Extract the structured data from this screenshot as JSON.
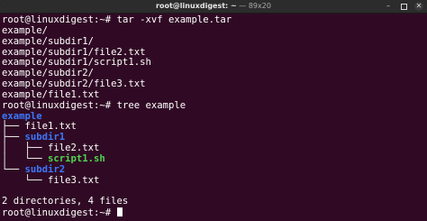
{
  "window": {
    "title_user": "root@linuxdigest: ~",
    "title_size": "89x20",
    "minimize_label": "–",
    "close_label": "✕"
  },
  "terminal": {
    "prompt": "root@linuxdigest:~#",
    "cmd1": " tar -xvf example.tar",
    "out": [
      "example/",
      "example/subdir1/",
      "example/subdir1/file2.txt",
      "example/subdir1/script1.sh",
      "example/subdir2/",
      "example/subdir2/file3.txt",
      "example/file1.txt"
    ],
    "cmd2": " tree example",
    "tree": {
      "root": "example",
      "l1_prefix": "├── ",
      "l1_file": "file1.txt",
      "l2_prefix": "├── ",
      "l2_dir": "subdir1",
      "l3_prefix": "│   ├── ",
      "l3_file": "file2.txt",
      "l4_prefix": "│   └── ",
      "l4_exec": "script1.sh",
      "l5_prefix": "└── ",
      "l5_dir": "subdir2",
      "l6_prefix": "    └── ",
      "l6_file": "file3.txt"
    },
    "summary": "2 directories, 4 files",
    "prompt_final": "root@linuxdigest:~#"
  }
}
